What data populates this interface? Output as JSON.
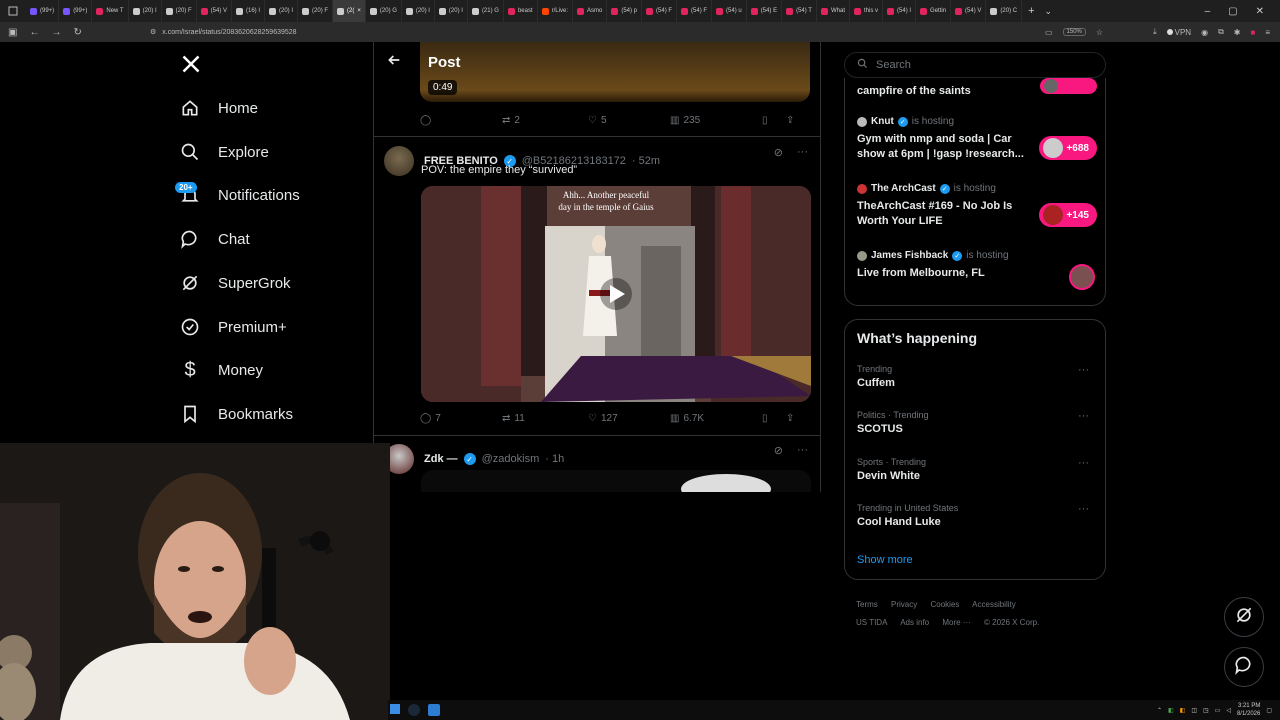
{
  "browser": {
    "tabs": [
      {
        "label": "(99+)",
        "color": "#7856ff"
      },
      {
        "label": "(99+)",
        "color": "#7856ff"
      },
      {
        "label": "New T",
        "color": "#e0245e"
      },
      {
        "label": "(20) I",
        "color": "#cccccc"
      },
      {
        "label": "(20) F",
        "color": "#cccccc"
      },
      {
        "label": "(54) V",
        "color": "#e0245e"
      },
      {
        "label": "(16) I",
        "color": "#cccccc"
      },
      {
        "label": "(20) I",
        "color": "#cccccc"
      },
      {
        "label": "(20) F",
        "color": "#cccccc"
      },
      {
        "label": "(2(",
        "color": "#cccccc",
        "active": true
      },
      {
        "label": "(20) G",
        "color": "#cccccc"
      },
      {
        "label": "(20) I",
        "color": "#cccccc"
      },
      {
        "label": "(20) I",
        "color": "#cccccc"
      },
      {
        "label": "(21) G",
        "color": "#cccccc"
      },
      {
        "label": "beast",
        "color": "#e0245e"
      },
      {
        "label": "r/Live:",
        "color": "#ff4500"
      },
      {
        "label": "Asmo",
        "color": "#e0245e"
      },
      {
        "label": "(54) p",
        "color": "#e0245e"
      },
      {
        "label": "(54) F",
        "color": "#e0245e"
      },
      {
        "label": "(54) F",
        "color": "#e0245e"
      },
      {
        "label": "(54) u",
        "color": "#e0245e"
      },
      {
        "label": "(54) E",
        "color": "#e0245e"
      },
      {
        "label": "(54) T",
        "color": "#e0245e"
      },
      {
        "label": "What",
        "color": "#e0245e"
      },
      {
        "label": "this v",
        "color": "#e0245e"
      },
      {
        "label": "(54) I",
        "color": "#e0245e"
      },
      {
        "label": "Gettin",
        "color": "#e0245e"
      },
      {
        "label": "(54) V",
        "color": "#e0245e"
      },
      {
        "label": "(20) C",
        "color": "#cccccc"
      }
    ],
    "url": "x.com/Israel/status/2083620628259639528",
    "zoom": "150%",
    "vpn_label": "VPN"
  },
  "nav": {
    "logo": "X",
    "notifications_badge": "20+",
    "items": [
      {
        "label": "Home",
        "icon": "home-icon"
      },
      {
        "label": "Explore",
        "icon": "search-icon"
      },
      {
        "label": "Notifications",
        "icon": "bell-icon"
      },
      {
        "label": "Chat",
        "icon": "chat-icon"
      },
      {
        "label": "SuperGrok",
        "icon": "grok-icon"
      },
      {
        "label": "Premium+",
        "icon": "premium-icon"
      },
      {
        "label": "Money",
        "icon": "money-icon"
      },
      {
        "label": "Bookmarks",
        "icon": "bookmark-icon"
      }
    ]
  },
  "post": {
    "header_title": "Post",
    "prev_tweet": {
      "duration": "0:49",
      "retweets": "2",
      "likes": "5",
      "views": "235"
    },
    "tweet1": {
      "name": "FREE BENITO",
      "handle": "@B52186213183172",
      "time": "· 52m",
      "text": "POV: the empire they “survived”",
      "caption_line1": "Ahh... Another peaceful",
      "caption_line2": "day in the temple of Gaius",
      "replies": "7",
      "retweets": "11",
      "likes": "127",
      "views": "6.7K"
    },
    "tweet2": {
      "name": "Zdk —",
      "handle": "@zadokism",
      "time": "· 1h"
    }
  },
  "right": {
    "search_placeholder": "Search",
    "spaces": [
      {
        "title": "campfire of the saints"
      },
      {
        "host": "Knut",
        "hosting": "is hosting",
        "title": "Gym with nmp and soda | Car show at 6pm | !gasp !research...",
        "count": "+688"
      },
      {
        "host": "The ArchCast",
        "hosting": "is hosting",
        "title": "TheArchCast #169 - No Job Is Worth Your LIFE",
        "count": "+145"
      },
      {
        "host": "James Fishback",
        "hosting": "is hosting",
        "title": "Live from Melbourne, FL"
      }
    ],
    "happening_title": "What’s happening",
    "trends": [
      {
        "context": "Trending",
        "name": "Cuffem"
      },
      {
        "context": "Politics · Trending",
        "name": "SCOTUS"
      },
      {
        "context": "Sports · Trending",
        "name": "Devin White"
      },
      {
        "context": "Trending in United States",
        "name": "Cool Hand Luke"
      }
    ],
    "show_more": "Show more",
    "footer": {
      "links_row1": [
        "Terms",
        "Privacy",
        "Cookies",
        "Accessibility"
      ],
      "links_row2": [
        "US TIDA",
        "Ads info",
        "More ···",
        "© 2026 X Corp."
      ]
    }
  },
  "taskbar": {
    "time": "3:21 PM",
    "date": "8/1/2026"
  }
}
